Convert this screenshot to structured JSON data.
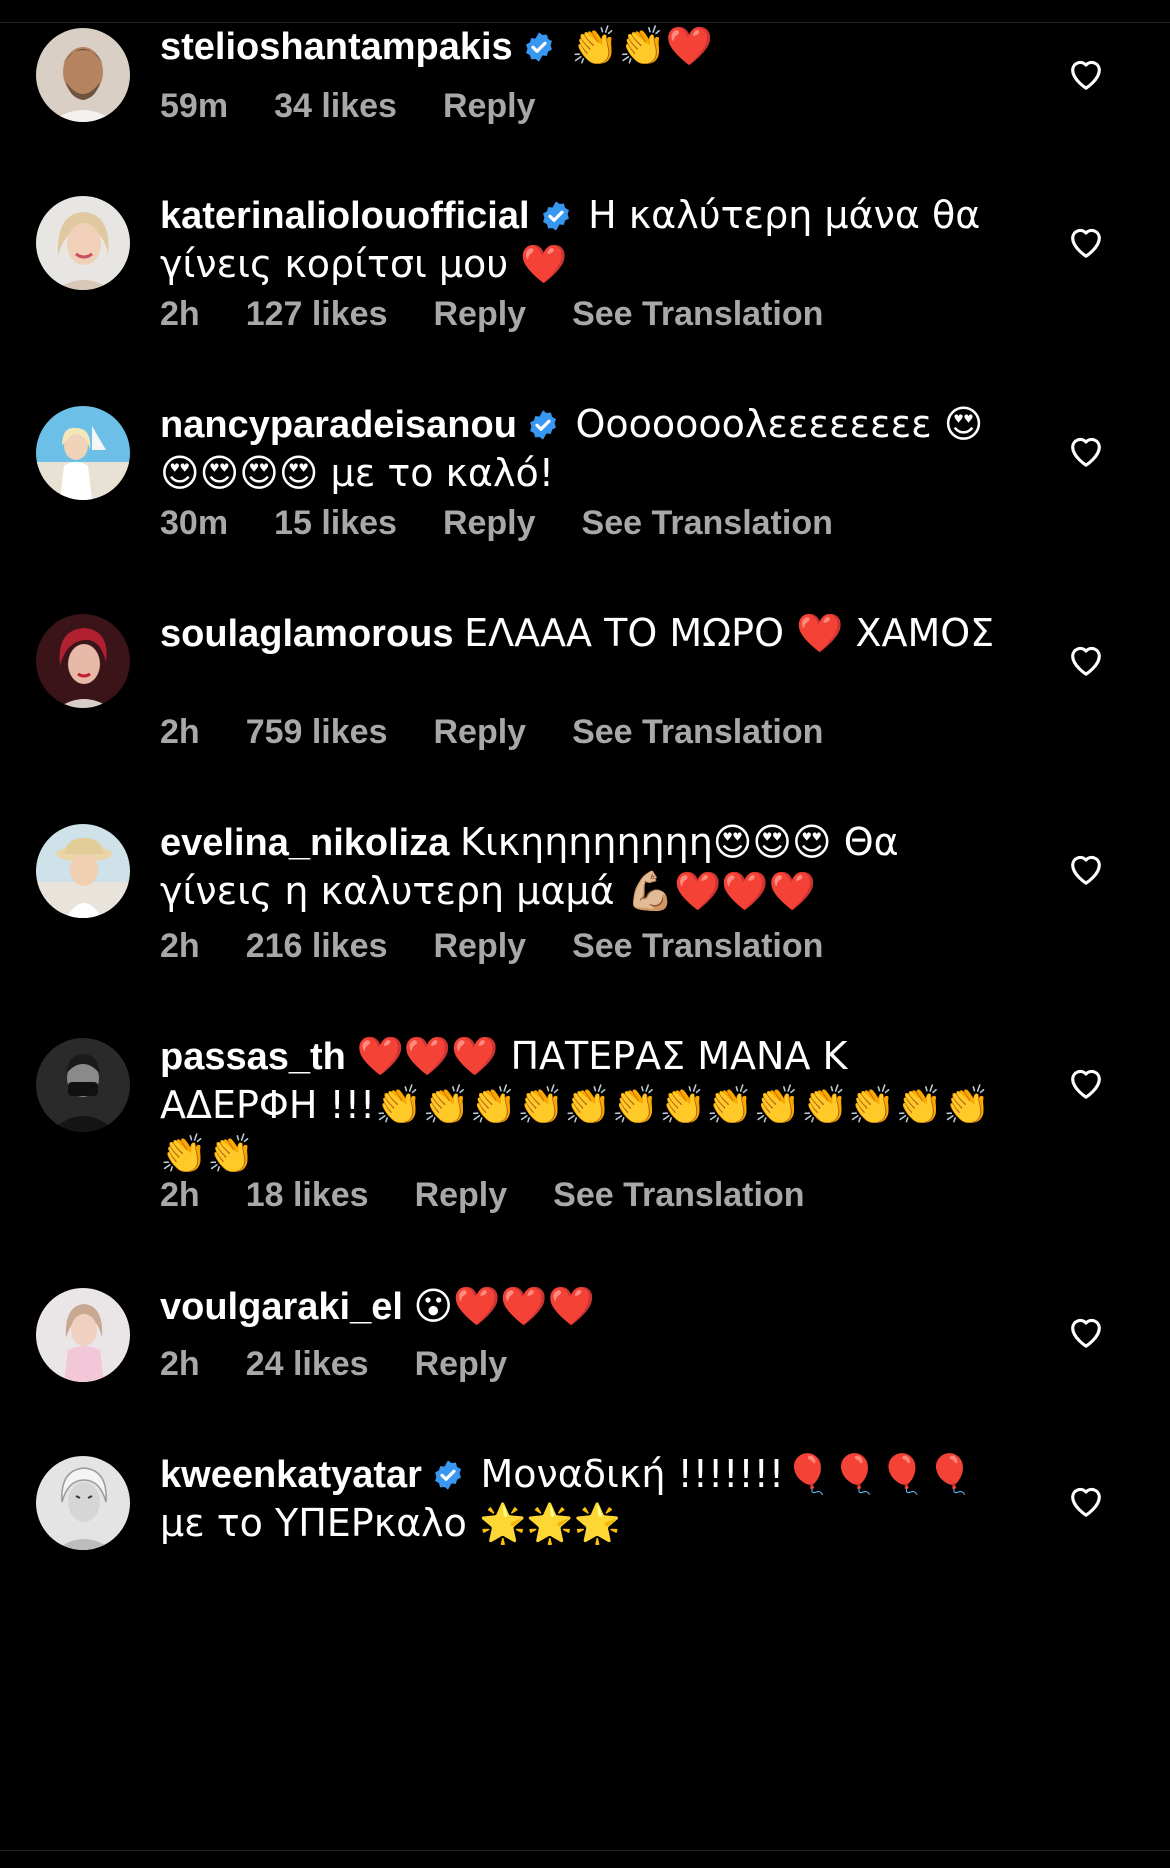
{
  "colors": {
    "background": "#000000",
    "text": "#ffffff",
    "meta": "#a8a8a8",
    "verified": "#3897f0"
  },
  "icons": {
    "verified": "verified-badge-icon",
    "like": "heart-outline-icon"
  },
  "comments": [
    {
      "username": "stelioshantampakis",
      "verified": true,
      "text": "👏👏❤️",
      "time": "59m",
      "likes": "34 likes",
      "reply": "Reply",
      "see_translation": ""
    },
    {
      "username": "katerinaliolouofficial",
      "verified": true,
      "text": "Η καλύτερη μάνα θα γίνεις κορίτσι μου ❤️",
      "time": "2h",
      "likes": "127 likes",
      "reply": "Reply",
      "see_translation": "See Translation"
    },
    {
      "username": "nancyparadeisanou",
      "verified": true,
      "text": "Οοοοοοολεεεεεεεε 😍😍😍😍😍 με το καλό!",
      "time": "30m",
      "likes": "15 likes",
      "reply": "Reply",
      "see_translation": "See Translation"
    },
    {
      "username": "soulaglamorous",
      "verified": false,
      "text": "ΕΛΑΑΑ ΤΟ ΜΩΡΟ ❤️ ΧΑΜΟΣ",
      "time": "2h",
      "likes": "759 likes",
      "reply": "Reply",
      "see_translation": "See Translation"
    },
    {
      "username": "evelina_nikoliza",
      "verified": false,
      "text": "Κικηηηηηηηη😍😍😍 Θα γίνεις η καλυτερη μαμά 💪🏼❤️❤️❤️",
      "time": "2h",
      "likes": "216 likes",
      "reply": "Reply",
      "see_translation": "See Translation"
    },
    {
      "username": "passas_th",
      "verified": false,
      "text": "❤️❤️❤️ ΠΑΤΕΡΑΣ ΜΑΝΑ Κ ΑΔΕΡΦΗ !!!👏👏👏👏👏👏👏👏👏👏👏👏👏👏👏",
      "time": "2h",
      "likes": "18 likes",
      "reply": "Reply",
      "see_translation": "See Translation"
    },
    {
      "username": "voulgaraki_el",
      "verified": false,
      "text": "😮❤️❤️❤️",
      "time": "2h",
      "likes": "24 likes",
      "reply": "Reply",
      "see_translation": ""
    },
    {
      "username": "kweenkatyatar",
      "verified": true,
      "text": "Μοναδική !!!!!!!🎈🎈🎈🎈 με το ΥΠΕΡκαλο 🌟🌟🌟",
      "time": "",
      "likes": "",
      "reply": "",
      "see_translation": ""
    }
  ]
}
